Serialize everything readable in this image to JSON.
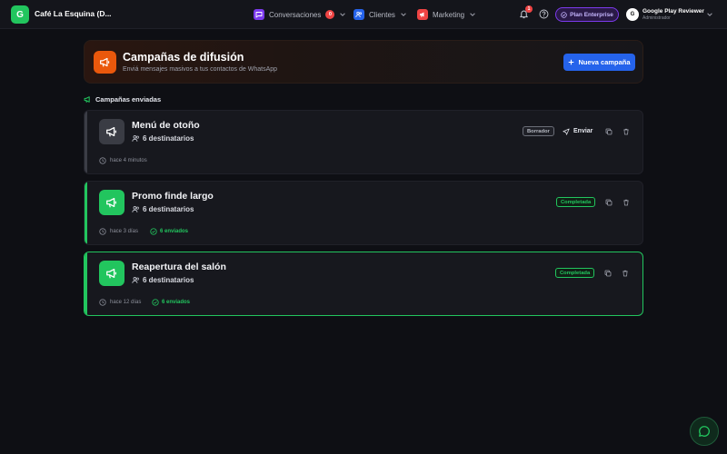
{
  "brand": {
    "initial": "G",
    "name": "Café La Esquina (D..."
  },
  "nav": {
    "conversaciones": {
      "label": "Conversaciones",
      "badge": "0"
    },
    "clientes": {
      "label": "Clientes"
    },
    "marketing": {
      "label": "Marketing"
    }
  },
  "notifications": {
    "count": "1"
  },
  "plan": {
    "label": "Plan Enterprise"
  },
  "user": {
    "initial": "G",
    "name": "Google Play Reviewer",
    "role": "Administrador"
  },
  "header": {
    "title": "Campañas de difusión",
    "subtitle": "Enviá mensajes masivos a tus contactos de WhatsApp",
    "new_button": "Nueva campaña"
  },
  "section": {
    "title": "Campañas enviadas"
  },
  "campaigns": [
    {
      "title": "Menú de otoño",
      "recipients": "6 destinatarios",
      "time": "hace 4 minutos",
      "status": "Borrador",
      "send_label": "Enviar",
      "sent": ""
    },
    {
      "title": "Promo finde largo",
      "recipients": "6 destinatarios",
      "time": "hace 3 días",
      "status": "Completada",
      "send_label": "",
      "sent": "6 enviados"
    },
    {
      "title": "Reapertura del salón",
      "recipients": "6 destinatarios",
      "time": "hace 12 días",
      "status": "Completada",
      "send_label": "",
      "sent": "6 enviados"
    }
  ],
  "colors": {
    "brand_green": "#22c55e",
    "accent_orange": "#ea580c",
    "primary_blue": "#2563eb",
    "enterprise_purple": "#7c3aed",
    "alert_red": "#ef4444"
  }
}
